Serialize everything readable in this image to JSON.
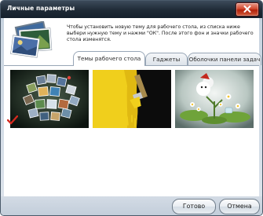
{
  "window": {
    "title": "Личные параметры"
  },
  "header": {
    "description": "Чтобы установить новую тему для рабочего стола, из списка ниже выбери нужную тему и нажми \"ОК\". После этого фон и значки рабочего стола изменятся."
  },
  "tabs": [
    {
      "label": "Темы рабочего стола",
      "selected": true
    },
    {
      "label": "Гаджеты",
      "selected": false
    },
    {
      "label": "Оболочки панели задач",
      "selected": false
    }
  ],
  "themes": [
    {
      "icon": "photo-collage-theme",
      "selected": true
    },
    {
      "icon": "paint-brush-theme",
      "selected": false
    },
    {
      "icon": "cartoon-flowers-theme",
      "selected": false
    }
  ],
  "footer": {
    "ok_label": "Готово",
    "cancel_label": "Отмена"
  },
  "colors": {
    "title_bar": "#1f2a36",
    "close_button": "#c8381c",
    "check_mark": "#d42a1f"
  }
}
